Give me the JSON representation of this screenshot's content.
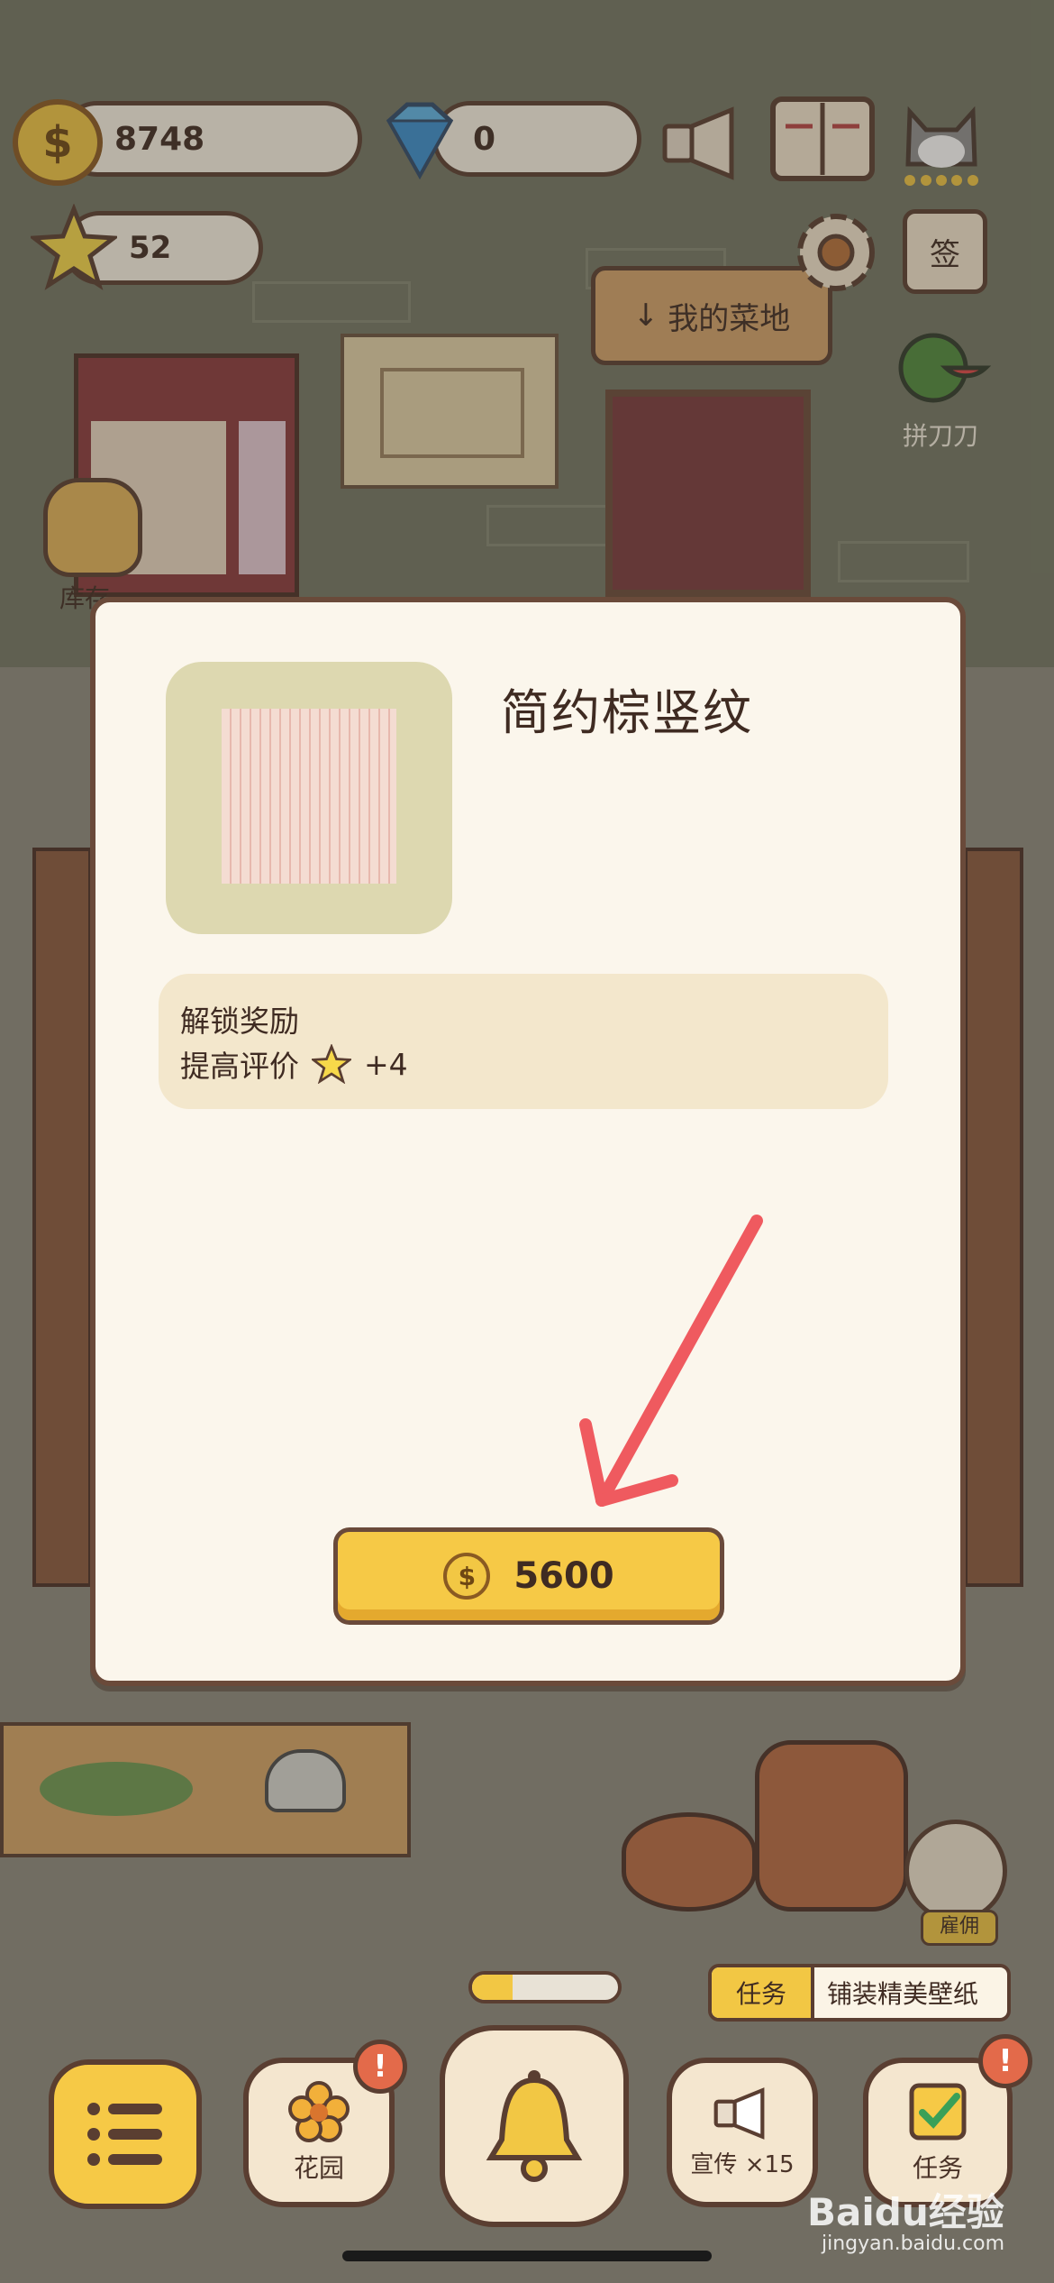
{
  "currency": {
    "coins": "8748",
    "diamonds": "0",
    "stars": "52"
  },
  "top_right": {
    "checkin_label": "签",
    "minigame_label": "拼刀刀"
  },
  "scene": {
    "my_field_label": "我的菜地",
    "storage_label": "库存"
  },
  "dialog": {
    "item_name": "简约棕竖纹",
    "reward_title": "解锁奖励",
    "reward_desc": "提高评价",
    "reward_value": "+4",
    "price": "5600"
  },
  "task_bar": {
    "tag": "任务",
    "text": "铺装精美壁纸"
  },
  "hire_label": "雇佣",
  "bottom_nav": {
    "garden": "花园",
    "promote": "宣传",
    "promote_count": "×15",
    "tasks": "任务",
    "badge_mark": "!"
  },
  "watermark": {
    "brand": "Baidu经验",
    "url": "jingyan.baidu.com"
  },
  "colors": {
    "panel": "#fbf6ec",
    "gold_button": "#f6c946",
    "outline": "#5a3e31",
    "arrow": "#ef5a5f",
    "badge": "#e36a4a"
  }
}
